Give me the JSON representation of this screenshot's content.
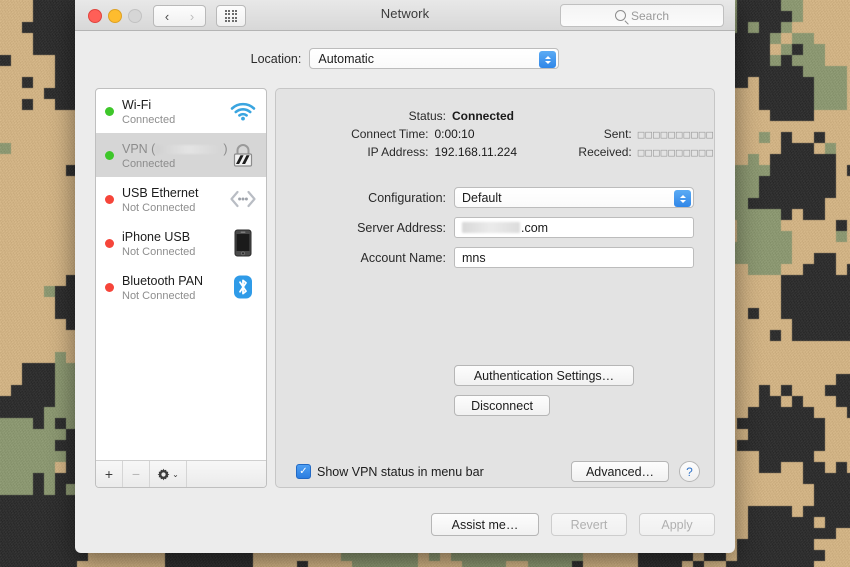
{
  "window": {
    "title": "Network",
    "traffic_lights": [
      "close",
      "minimize",
      "zoom"
    ],
    "nav": {
      "back": "‹",
      "forward": "›"
    },
    "grid_button_name": "show-all",
    "search": {
      "placeholder": "Search",
      "value": ""
    }
  },
  "location": {
    "label": "Location:",
    "selected": "Automatic",
    "options": [
      "Automatic"
    ]
  },
  "sidebar": {
    "services": [
      {
        "name": "Wi-Fi",
        "status": "Connected",
        "dot": "green",
        "icon": "wifi-icon",
        "selected": false,
        "redacted": false
      },
      {
        "name": "VPN (",
        "name_suffix": ")",
        "status": "Connected",
        "dot": "green",
        "icon": "lock-icon",
        "selected": true,
        "redacted": true
      },
      {
        "name": "USB Ethernet",
        "status": "Not Connected",
        "dot": "red",
        "icon": "ethernet-icon",
        "selected": false,
        "redacted": false
      },
      {
        "name": "iPhone USB",
        "status": "Not Connected",
        "dot": "red",
        "icon": "iphone-icon",
        "selected": false,
        "redacted": false
      },
      {
        "name": "Bluetooth PAN",
        "status": "Not Connected",
        "dot": "red",
        "icon": "bluetooth-icon",
        "selected": false,
        "redacted": false
      }
    ],
    "toolbar": {
      "add": "+",
      "remove": "−",
      "actions_icon": "gear-icon",
      "actions_chevron": "⌄"
    }
  },
  "detail": {
    "status_label": "Status:",
    "status_value": "Connected",
    "connect_time_label": "Connect Time:",
    "connect_time_value": "0:00:10",
    "ip_label": "IP Address:",
    "ip_value": "192.168.11.224",
    "sent_label": "Sent:",
    "sent_value": "□□□□□□□□□□",
    "received_label": "Received:",
    "received_value": "□□□□□□□□□□",
    "configuration_label": "Configuration:",
    "configuration_value": "Default",
    "server_address_label": "Server Address:",
    "server_address_value": ".com",
    "account_name_label": "Account Name:",
    "account_name_value": "mns",
    "auth_settings_button": "Authentication Settings…",
    "disconnect_button": "Disconnect",
    "show_status_checkbox_label": "Show VPN status in menu bar",
    "show_status_checked": true,
    "checkmark": "✓",
    "advanced_button": "Advanced…",
    "help_button": "?"
  },
  "footer": {
    "assist_button": "Assist me…",
    "revert_button": "Revert",
    "apply_button": "Apply"
  },
  "colors": {
    "accent_blue": "#2f86e8",
    "status_connected": "#3ec72a",
    "status_disconnected": "#f6453a",
    "camo_tan": "#cfb183",
    "camo_olive": "#8a9670",
    "camo_dark": "#2e2e2e"
  }
}
